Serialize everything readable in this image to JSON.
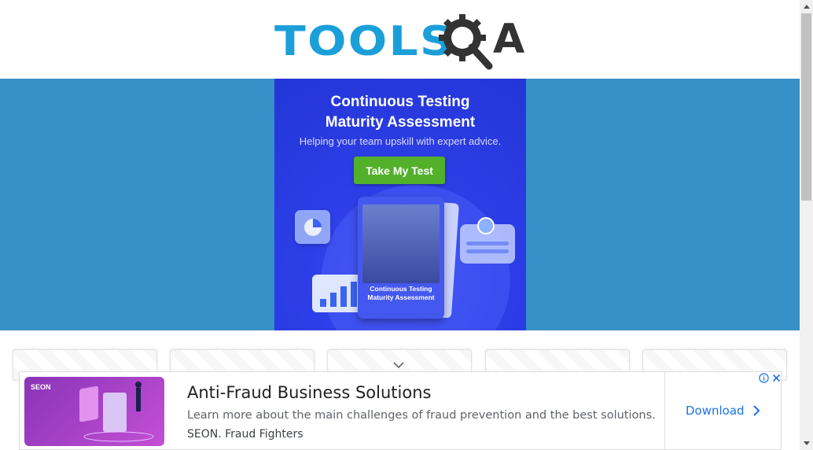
{
  "header": {
    "logo_text": "TOOLS",
    "logo_suffix": "A",
    "logo_icon": "gear-magnifier-icon"
  },
  "banner_ad": {
    "title_line1": "Continuous Testing",
    "title_line2": "Maturity Assessment",
    "subtitle": "Helping your team upskill with expert advice.",
    "button_label": "Take My Test",
    "card_title_line1": "Continuous Testing",
    "card_title_line2": "Maturity Assessment",
    "colors": {
      "background": "#3790c7",
      "ad_bg": "#2d3ee8",
      "button": "#52b02b"
    }
  },
  "cards_row": {
    "count": 5,
    "chevron_icon": "chevron-down-icon"
  },
  "bottom_ad": {
    "brand": "SEON",
    "title": "Anti-Fraud Business Solutions",
    "description": "Learn more about the main challenges of fraud prevention and the best solutions.",
    "source": "SEON. Fraud Fighters",
    "cta_label": "Download",
    "info_icon": "info-icon",
    "close_icon": "close-icon"
  },
  "scrollbar": {
    "up_icon": "arrow-up-icon",
    "down_icon": "arrow-down-icon"
  }
}
